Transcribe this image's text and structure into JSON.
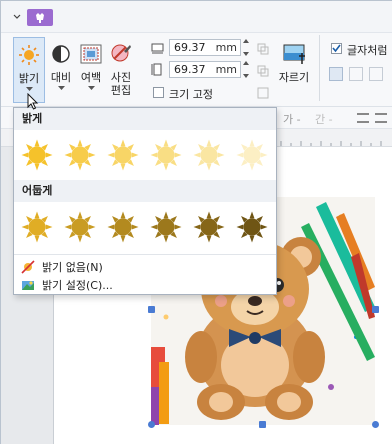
{
  "ribbon": {
    "brightness_label": "밝기",
    "contrast_label": "대비",
    "margin_label": "여백",
    "photo_edit_label": "사진\n편집",
    "width_value": "69.37",
    "height_value": "69.37",
    "unit": "mm",
    "fix_size_label": "크기 고정",
    "crop_label": "자르기",
    "text_like_label": "글자처럼"
  },
  "menu": {
    "bright_header": "밝게",
    "dark_header": "어둡게",
    "no_brightness": "밝기 없음(N)",
    "brightness_settings": "밝기 설정(C)...",
    "bright_swatches": [
      "#f5c22b",
      "#f7cc4a",
      "#f8d566",
      "#f9de84",
      "#fae6a2",
      "#fcefc4"
    ],
    "dark_swatches": [
      "#e0ad25",
      "#c99c23",
      "#b38a1f",
      "#9c781c",
      "#866618",
      "#6f5514"
    ]
  },
  "icons": {
    "quick_tab": "image-tab-icon",
    "brightness": "sun-icon",
    "contrast": "contrast-icon",
    "margin": "margin-icon",
    "photo_edit": "photo-edit-icon",
    "crop": "crop-icon",
    "no_brightness": "no-brightness-icon",
    "brightness_settings": "brightness-settings-icon"
  }
}
